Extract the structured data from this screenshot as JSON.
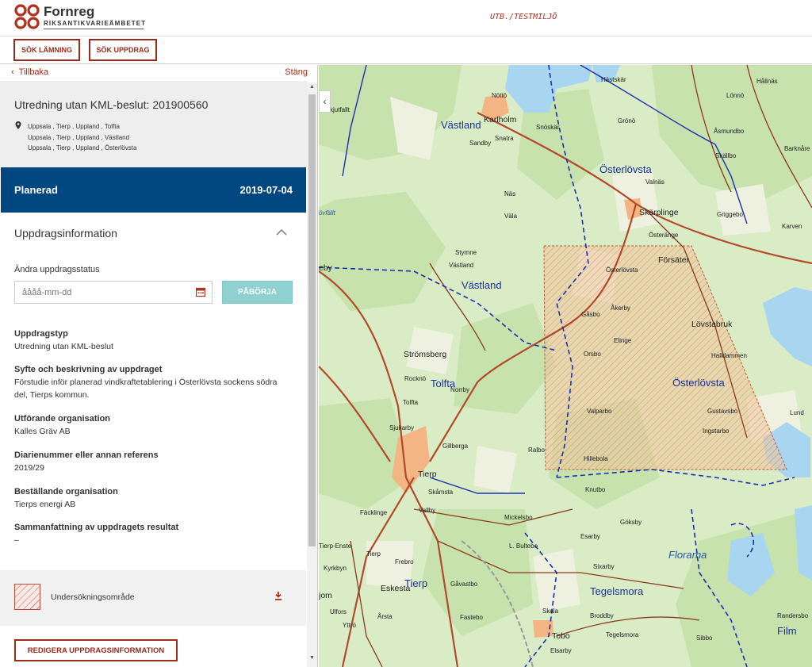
{
  "header": {
    "logo_name": "Fornreg",
    "logo_sub": "RIKSANTIKVARIEÄMBETET",
    "environment": "UTB./TESTMILJÖ"
  },
  "nav": {
    "search_remains": "SÖK LÄMNING",
    "search_assignment": "SÖK UPPDRAG"
  },
  "sidebar": {
    "back": "Tillbaka",
    "close": "Stäng",
    "title": "Utredning utan KML-beslut: 201900560",
    "places": [
      "Uppsala , Tierp , Uppland , Tolfta",
      "Uppsala , Tierp , Uppland , Västland",
      "Uppsala , Tierp , Uppland , Österlövsta"
    ],
    "status": "Planerad",
    "status_date": "2019-07-04",
    "section_title": "Uppdragsinformation",
    "change_status_label": "Ändra uppdragsstatus",
    "date_placeholder": "åååå-mm-dd",
    "start_button": "PÅBÖRJA",
    "fields": [
      {
        "label": "Uppdragstyp",
        "value": "Utredning utan KML-beslut"
      },
      {
        "label": "Syfte och beskrivning av uppdraget",
        "value": "Förstudie inför planerad vindkraftetablering i Österlövsta sockens södra del, Tierps kommun."
      },
      {
        "label": "Utförande organisation",
        "value": "Kalles Gräv AB"
      },
      {
        "label": "Diarienummer eller annan referens",
        "value": "2019/29"
      },
      {
        "label": "Beställande organisation",
        "value": "Tierps energi AB"
      },
      {
        "label": "Sammanfattning av uppdragets resultat",
        "value": "–"
      }
    ],
    "legend_label": "Undersökningsområde",
    "edit_button": "REDIGERA UPPDRAGSINFORMATION"
  },
  "map": {
    "collapse_glyph": "‹",
    "labels": {
      "hastskar": "Hästskär",
      "hallnas": "Hållnäs",
      "notto": "Nöttö",
      "kjutfallt": "kjutfallt",
      "vastland_n": "Västland",
      "karlholm": "Karlholm",
      "snoskar": "Snöskär",
      "grono": "Grönö",
      "lonno": "Lönnö",
      "asmundbo": "Åsmundbo",
      "snatra": "Snatra",
      "barknare": "Barknåre",
      "sandby": "Sandby",
      "osterlovsta_n": "Österlövsta",
      "skallbo": "Skällbo",
      "valnas": "Valnäs",
      "nas": "Näs",
      "ovfallt": "övfällt",
      "skarplinge": "Skärplinge",
      "griggebo": "Griggebo",
      "vala": "Väla",
      "karven": "Karven",
      "osterange": "Österänge",
      "stymne": "Stymne",
      "forsater": "Försäter",
      "eby": "eby",
      "vastland_s": "Västland",
      "vastland_s2": "Västland",
      "osterlovsta_p": "Österlövsta",
      "akerby": "Åkerby",
      "gasbo": "Gåsbo",
      "lovstabruk": "Lövstabruk",
      "stromsberg": "Strömsberg",
      "elinge": "Elinge",
      "orsbo": "Orsbo",
      "halldammen": "Halldammen",
      "rocknö": "Rocknö",
      "tolfta": "Tolfta",
      "norrby": "Norrby",
      "tolfta_s": "Tolfta",
      "osterlovsta_s": "Österlövsta",
      "valparbo": "Valparbo",
      "gustavsbo": "Gustavsbo",
      "sjukarby": "Sjukarby",
      "gillberga": "Gillberga",
      "ingstarbo": "Ingstarbo",
      "ralbo": "Ralbo",
      "hillebola": "Hillebola",
      "tierp": "Tierp",
      "skamsta": "Skåmsta",
      "knutbo": "Knutbo",
      "fackinge": "Fäcklinge",
      "vallby": "Vallby",
      "mickelsbo": "Mickelsbo",
      "goksby": "Göksby",
      "esarby": "Esarby",
      "florarna": "Florarna",
      "tierp_enst": "Tierp-Enste",
      "lbultebo": "L. Bultebo",
      "tierp_s": "Tierp",
      "frebro": "Frebro",
      "sixarby": "Sixarby",
      "kyrkbyn": "Kyrkbyn",
      "eskesta": "Eskesta",
      "tierp_b": "Tierp",
      "gavastbo": "Gåvastbo",
      "tegelsmora": "Tegelsmora",
      "ulfors": "Ulfors",
      "arsta": "Årsta",
      "skala": "Skala",
      "broddby": "Broddby",
      "yttro": "Yttrö",
      "fastebo": "Fastebo",
      "tobo": "Tobo",
      "tegelsmora_s": "Tegelsmora",
      "sibbo": "Sibbo",
      "film": "Film",
      "randersbo": "Randersbo",
      "elsarby": "Elsarby",
      "jom": "jom",
      "lund": "Lund"
    }
  }
}
